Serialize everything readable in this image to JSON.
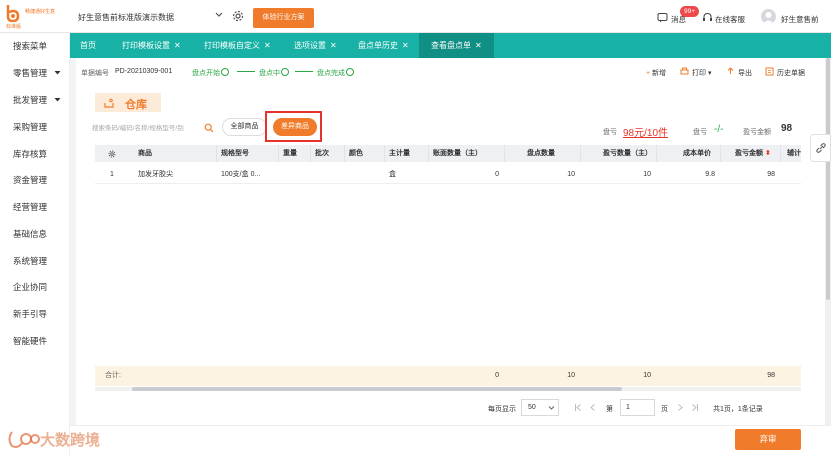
{
  "app": {
    "brand": "畅捷通好生意",
    "edition": "标准版",
    "company": "好生意售前标准版演示数据",
    "trial_button": "体验行业方案",
    "messages_label": "消息",
    "messages_badge": "99+",
    "service_label": "在线客服",
    "user_name": "好生意售前"
  },
  "sidebar": {
    "items": [
      {
        "label": "搜索菜单",
        "has_caret": false
      },
      {
        "label": "零售管理",
        "has_caret": true
      },
      {
        "label": "批发管理",
        "has_caret": true
      },
      {
        "label": "采购管理",
        "has_caret": false
      },
      {
        "label": "库存核算",
        "has_caret": false
      },
      {
        "label": "资金管理",
        "has_caret": false
      },
      {
        "label": "经营管理",
        "has_caret": false
      },
      {
        "label": "基础信息",
        "has_caret": false
      },
      {
        "label": "系统管理",
        "has_caret": false
      },
      {
        "label": "企业协同",
        "has_caret": false
      },
      {
        "label": "新手引导",
        "has_caret": false
      },
      {
        "label": "智能硬件",
        "has_caret": false
      }
    ]
  },
  "tabs": [
    {
      "label": "首页",
      "closable": false,
      "active": false
    },
    {
      "label": "打印模板设置",
      "closable": true,
      "active": false
    },
    {
      "label": "打印模板自定义",
      "closable": true,
      "active": false
    },
    {
      "label": "选项设置",
      "closable": true,
      "active": false
    },
    {
      "label": "盘点单历史",
      "closable": true,
      "active": false
    },
    {
      "label": "查看盘点单",
      "closable": true,
      "active": true
    }
  ],
  "doc": {
    "number_label": "单据编号",
    "number": "PD-20210309-001",
    "steps": [
      "盘点开始",
      "盘点中",
      "盘点完成"
    ],
    "actions": [
      "新增",
      "打印",
      "导出",
      "历史单据"
    ],
    "warehouse": "仓库",
    "search_placeholder": "搜索条码/编码/名称/规格型号/别",
    "filter_all": "全部商品",
    "filter_diff": "差异商品",
    "loss_label": "盘亏",
    "loss_value": "98元/10件",
    "gain_label": "盘亏",
    "gain_value": "-/-",
    "amount_label": "盈亏金额",
    "amount_value": "98"
  },
  "table": {
    "columns": [
      "商品",
      "规格型号",
      "重量",
      "批次",
      "颜色",
      "主计量",
      "账面数量（主）",
      "盘点数量",
      "盈亏数量（主）",
      "成本单价",
      "盈亏金额",
      "辅计"
    ],
    "rows": [
      [
        "1",
        "加发牙胶尖",
        "100支/盒 0...",
        "",
        "",
        "",
        "盒",
        "0",
        "10",
        "10",
        "9.8",
        "98"
      ]
    ],
    "totals_label": "合计:",
    "totals": [
      "0",
      "10",
      "10",
      "98"
    ]
  },
  "pagination": {
    "page_size_label": "每页显示",
    "page_size": "50",
    "page_prefix": "第",
    "page": "1",
    "page_suffix": "页",
    "summary": "共1页，1条记录"
  },
  "footer": {
    "save_button": "弃审",
    "watermark": "大数跨境"
  },
  "colors": {
    "teal": "#18b1a5",
    "orange": "#f07b2a",
    "red": "#e8332a",
    "green": "#29a745"
  }
}
